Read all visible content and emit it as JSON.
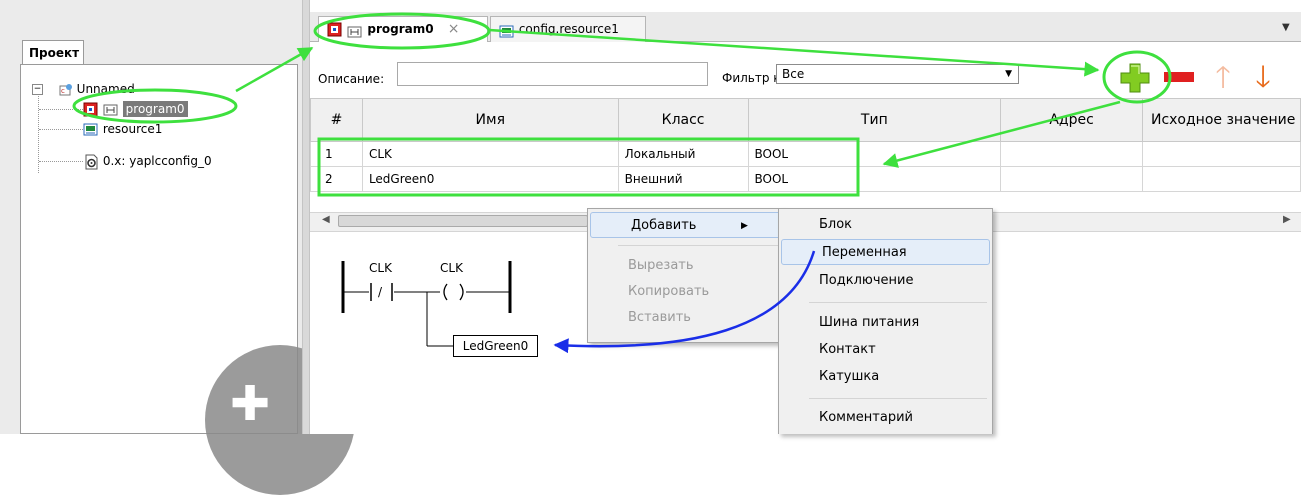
{
  "project_panel": {
    "tab_label": "Проект",
    "tree": [
      {
        "label": "Unnamed",
        "icon": "plc-project-icon"
      },
      {
        "label": "program0",
        "icon": "program-icon",
        "selected": true
      },
      {
        "label": "resource1",
        "icon": "resource-icon"
      },
      {
        "label": "0.x: yaplcconfig_0",
        "icon": "config-icon"
      }
    ]
  },
  "tabs": [
    {
      "label": "program0",
      "active": true,
      "close_glyph": "×"
    },
    {
      "label": "config.resource1",
      "active": false
    }
  ],
  "toolbar": {
    "description_label": "Описание:",
    "description_value": "",
    "filter_label": "Фильтр класса:",
    "filter_value": "Все",
    "add_icon": "plus-icon",
    "delete_icon": "minus-icon",
    "up_icon": "arrow-up-icon",
    "down_icon": "arrow-down-icon"
  },
  "table": {
    "columns": [
      "#",
      "Имя",
      "Класс",
      "Тип",
      "Адрес",
      "Исходное значение"
    ],
    "rows": [
      [
        "1",
        "CLK",
        "Локальный",
        "BOOL",
        "",
        ""
      ],
      [
        "2",
        "LedGreen0",
        "Внешний",
        "BOOL",
        "",
        ""
      ]
    ]
  },
  "ladder": {
    "contact_label": "CLK",
    "contact_symbol": "/",
    "coil_label": "CLK",
    "variable_block": "LedGreen0"
  },
  "context_menu": {
    "items": [
      {
        "label": "Добавить",
        "enabled": true,
        "submenu": true
      },
      {
        "label": "Вырезать",
        "enabled": false
      },
      {
        "label": "Копировать",
        "enabled": false
      },
      {
        "label": "Вставить",
        "enabled": false
      }
    ]
  },
  "submenu": {
    "items": [
      "Блок",
      "Переменная",
      "Подключение",
      "Шина питания",
      "Контакт",
      "Катушка",
      "Комментарий"
    ],
    "highlighted": "Переменная"
  },
  "colors": {
    "annotation_green": "#3ee03e",
    "annotation_blue": "#1a2ee8",
    "add_green": "#7cc81e",
    "delete_red": "#e02020"
  }
}
